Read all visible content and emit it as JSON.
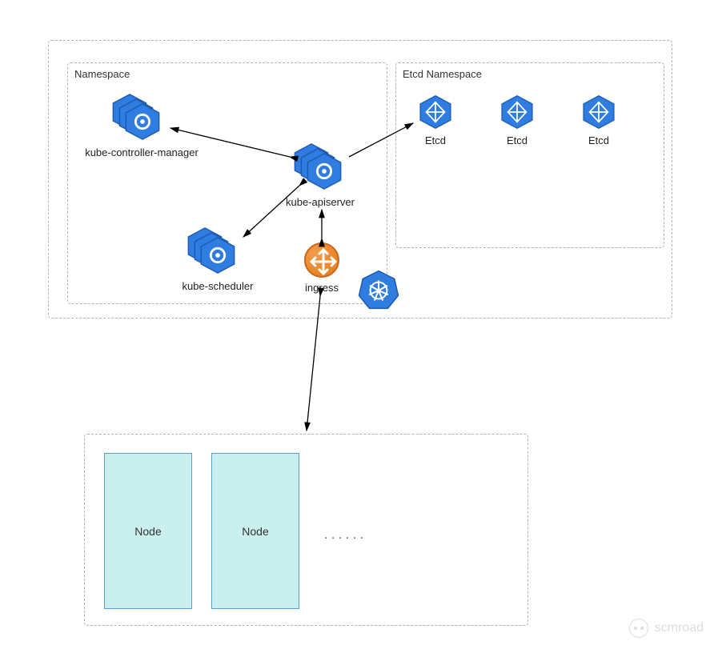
{
  "topCluster": {
    "namespace": {
      "label": "Namespace",
      "controllerManager": "kube-controller-manager",
      "scheduler": "kube-scheduler",
      "apiserver": "kube-apiserver",
      "ingress": "ingress"
    },
    "etcdNamespace": {
      "label": "Etcd Namespace",
      "node1": "Etcd",
      "node2": "Etcd",
      "node3": "Etcd"
    }
  },
  "bottomCluster": {
    "node1": "Node",
    "node2": "Node",
    "more": ". . .  . . ."
  },
  "watermark": "scmroad",
  "colors": {
    "hexBlue": "#2f7de1",
    "hexDark": "#1e5bb0",
    "ingress": "#e88a2e",
    "nodeFill": "#c9f0ef",
    "nodeBorder": "#5aa0c8"
  }
}
